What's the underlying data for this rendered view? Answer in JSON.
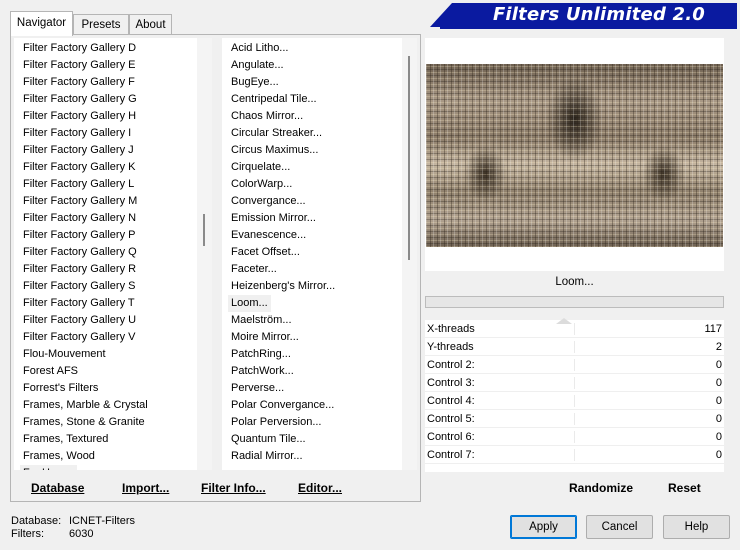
{
  "app_title": "Filters Unlimited 2.0",
  "tabs": [
    {
      "label": "Navigator"
    },
    {
      "label": "Presets"
    },
    {
      "label": "About"
    }
  ],
  "categories": [
    "Filter Factory Gallery D",
    "Filter Factory Gallery E",
    "Filter Factory Gallery F",
    "Filter Factory Gallery G",
    "Filter Factory Gallery H",
    "Filter Factory Gallery I",
    "Filter Factory Gallery J",
    "Filter Factory Gallery K",
    "Filter Factory Gallery L",
    "Filter Factory Gallery M",
    "Filter Factory Gallery N",
    "Filter Factory Gallery P",
    "Filter Factory Gallery Q",
    "Filter Factory Gallery R",
    "Filter Factory Gallery S",
    "Filter Factory Gallery T",
    "Filter Factory Gallery U",
    "Filter Factory Gallery V",
    "Flou-Mouvement",
    "Forest AFS",
    "Forrest's Filters",
    "Frames, Marble & Crystal",
    "Frames, Stone & Granite",
    "Frames, Textured",
    "Frames, Wood",
    "FunHouse"
  ],
  "selected_category": "FunHouse",
  "filters": [
    "Acid Litho...",
    "Angulate...",
    "BugEye...",
    "Centripedal Tile...",
    "Chaos Mirror...",
    "Circular Streaker...",
    "Circus Maximus...",
    "Cirquelate...",
    "ColorWarp...",
    "Convergance...",
    "Emission Mirror...",
    "Evanescence...",
    "Facet Offset...",
    "Faceter...",
    "Heizenberg's Mirror...",
    "Loom...",
    "Maelström...",
    "Moire Mirror...",
    "PatchRing...",
    "PatchWork...",
    "Perverse...",
    "Polar Convergance...",
    "Polar Perversion...",
    "Quantum Tile...",
    "Radial Mirror..."
  ],
  "selected_filter": "Loom...",
  "nav_buttons": {
    "database": "Database",
    "import": "Import...",
    "filter_info": "Filter Info...",
    "editor": "Editor..."
  },
  "current_filter_name": "Loom...",
  "controls": [
    {
      "label": "X-threads",
      "value": "117"
    },
    {
      "label": "Y-threads",
      "value": "2"
    },
    {
      "label": "Control 2:",
      "value": "0"
    },
    {
      "label": "Control 3:",
      "value": "0"
    },
    {
      "label": "Control 4:",
      "value": "0"
    },
    {
      "label": "Control 5:",
      "value": "0"
    },
    {
      "label": "Control 6:",
      "value": "0"
    },
    {
      "label": "Control 7:",
      "value": "0"
    }
  ],
  "randomize_label": "Randomize",
  "reset_label": "Reset",
  "status": {
    "database_label": "Database:",
    "database_value": "ICNET-Filters",
    "filters_label": "Filters:",
    "filters_value": "6030"
  },
  "dialog": {
    "apply": "Apply",
    "cancel": "Cancel",
    "help": "Help"
  },
  "colors": {
    "banner": "#0a1aa0",
    "accent_focus": "#0078d7"
  }
}
